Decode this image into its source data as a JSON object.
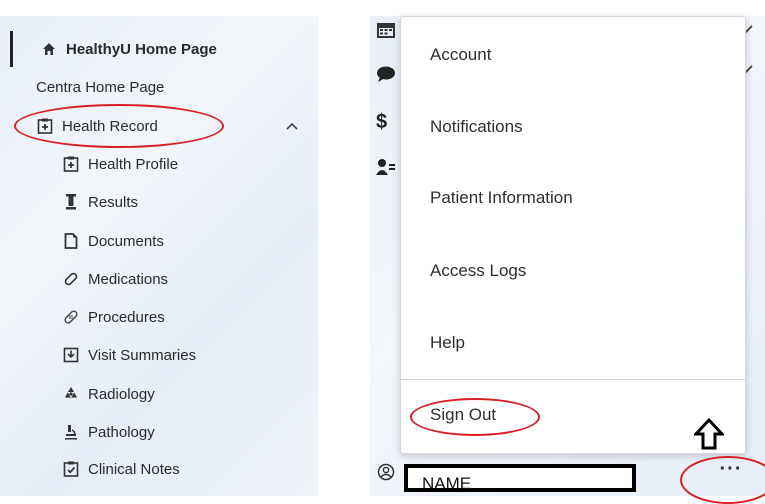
{
  "left_nav": {
    "items": [
      {
        "label": "HealthyU Home Page",
        "icon": "home-icon"
      },
      {
        "label": "Centra Home Page",
        "icon": ""
      },
      {
        "label": "Health Record",
        "icon": "medical-record-icon"
      },
      {
        "label": "Health Profile",
        "icon": "medical-record-icon"
      },
      {
        "label": "Results",
        "icon": "test-tube-icon"
      },
      {
        "label": "Documents",
        "icon": "document-icon"
      },
      {
        "label": "Medications",
        "icon": "pill-icon"
      },
      {
        "label": "Procedures",
        "icon": "bandage-icon"
      },
      {
        "label": "Visit Summaries",
        "icon": "download-box-icon"
      },
      {
        "label": "Radiology",
        "icon": "radiology-icon"
      },
      {
        "label": "Pathology",
        "icon": "microscope-icon"
      },
      {
        "label": "Clinical Notes",
        "icon": "notes-icon"
      }
    ]
  },
  "account_menu": {
    "items": [
      {
        "label": "Account"
      },
      {
        "label": "Notifications"
      },
      {
        "label": "Patient Information"
      },
      {
        "label": "Access Logs"
      },
      {
        "label": "Help"
      },
      {
        "label": "Sign Out"
      }
    ]
  },
  "footer": {
    "user_name": "NAME",
    "more_label": "···"
  },
  "colors": {
    "highlight_red": "#d81f26",
    "panel_bg": "#eef3f9"
  }
}
